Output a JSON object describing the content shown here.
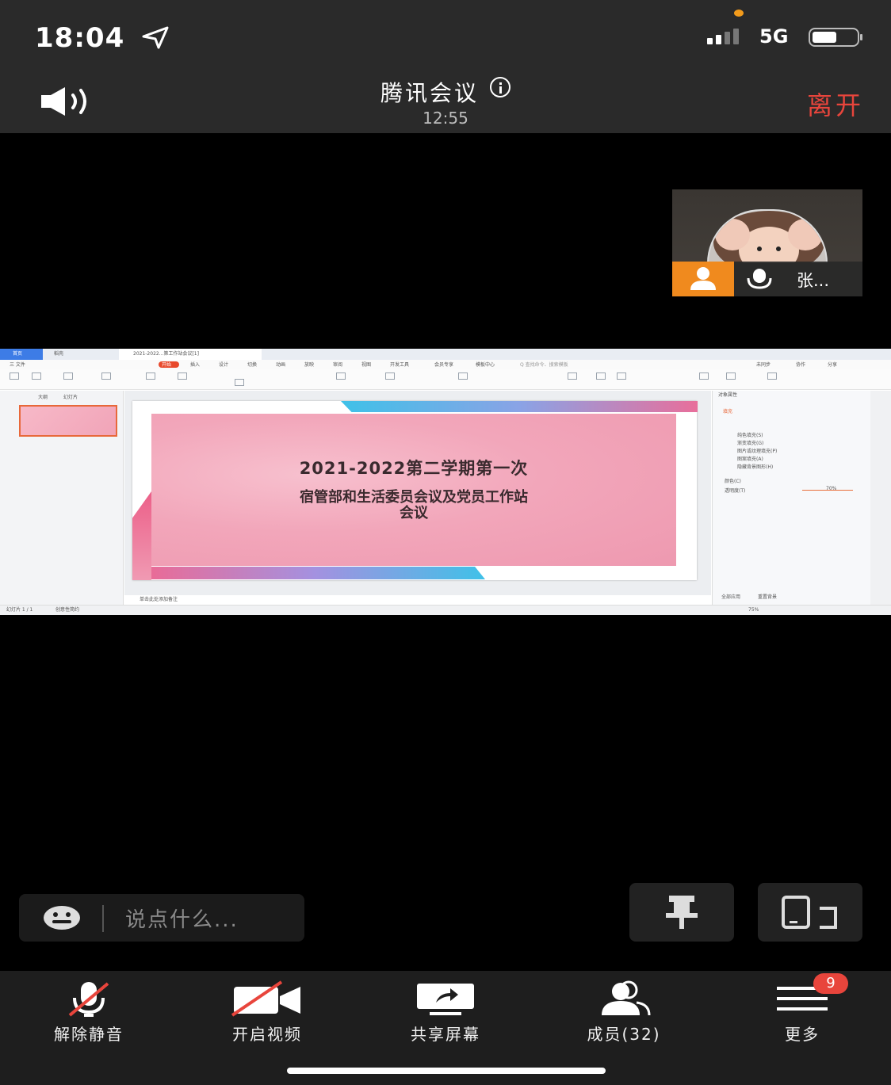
{
  "status_bar": {
    "time": "18:04",
    "network": "5G",
    "icons": [
      "location-arrow-icon",
      "signal-icon",
      "battery-icon"
    ]
  },
  "header": {
    "app_title": "腾讯会议",
    "duration": "12:55",
    "leave_label": "离开",
    "leave_color": "#e8453c",
    "icons": [
      "speaker-icon",
      "info-icon"
    ]
  },
  "video_tile": {
    "name": "张...",
    "badge_color": "#f08a1e"
  },
  "shared_screen": {
    "app_tab_home": "首页",
    "app_tab_wps": "稻壳",
    "doc_tab": "2021-2022...第工作站会议[1]",
    "menu": [
      "三 文件",
      "开始",
      "插入",
      "设计",
      "切换",
      "动画",
      "放映",
      "审阅",
      "视图",
      "开发工具",
      "会员专享",
      "模板中心",
      "Q 查找命令、搜索模板"
    ],
    "menu_right": [
      "未同步",
      "协作",
      "分享"
    ],
    "left_tabs": [
      "大纲",
      "幻灯片"
    ],
    "slide_title_1": "2021-2022第二学期第一次",
    "slide_title_2": "宿管部和生活委员会议及党员工作站",
    "slide_title_3": "会议",
    "notes_placeholder": "单击此处添加备注",
    "status_left": "幻灯片 1 / 1",
    "status_theme": "创意性简约",
    "zoom": "75%",
    "panel_title": "对象属性",
    "panel_tab": "填充",
    "fill_options": [
      "纯色填充(S)",
      "渐变填充(G)",
      "图片或纹理填充(P)",
      "图案填充(A)",
      "隐藏背景图形(H)"
    ],
    "color_label": "颜色(C)",
    "transparency_label": "透明度(T)",
    "transparency_value": "70%",
    "apply_all": "全部应用",
    "reset_bg": "重置背景"
  },
  "chat": {
    "placeholder": "说点什么..."
  },
  "toolbar": {
    "items": [
      {
        "label": "解除静音",
        "icon": "mic-muted-icon"
      },
      {
        "label": "开启视频",
        "icon": "video-off-icon"
      },
      {
        "label": "共享屏幕",
        "icon": "share-screen-icon"
      },
      {
        "label": "成员(32)",
        "icon": "members-icon"
      },
      {
        "label": "更多",
        "icon": "more-icon"
      }
    ],
    "more_badge": "9"
  }
}
